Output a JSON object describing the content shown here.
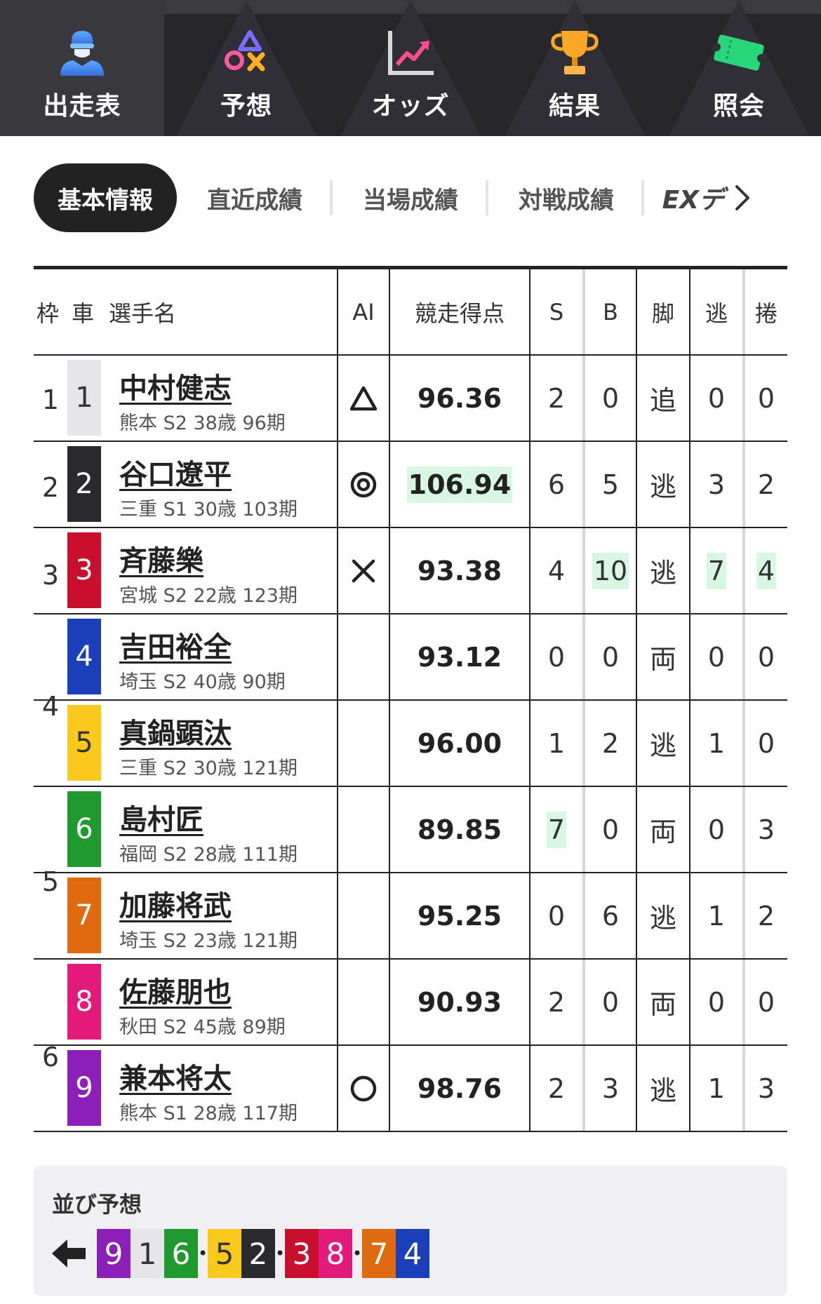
{
  "nav": {
    "items": [
      {
        "label": "出走表",
        "icon": "racer-icon",
        "active": true
      },
      {
        "label": "予想",
        "icon": "prediction-marks-icon",
        "active": false
      },
      {
        "label": "オッズ",
        "icon": "odds-chart-icon",
        "active": false
      },
      {
        "label": "結果",
        "icon": "trophy-icon",
        "active": false
      },
      {
        "label": "照会",
        "icon": "ticket-icon",
        "active": false
      }
    ]
  },
  "subtabs": {
    "items": [
      "基本情報",
      "直近成績",
      "当場成績",
      "対戦成績",
      "EXデ"
    ],
    "active": "基本情報"
  },
  "table": {
    "headers": {
      "waku": "枠",
      "car": "車",
      "name": "選手名",
      "ai": "AI",
      "score": "競走得点",
      "s": "S",
      "b": "B",
      "kyaku": "脚",
      "nige": "逃",
      "makuri": "捲"
    },
    "rows": [
      {
        "car": "1",
        "name": "中村健志",
        "info": "熊本 S2 38歳 96期",
        "ai": "△",
        "score": "96.36",
        "s": "2",
        "b": "0",
        "kyaku": "追",
        "nige": "0",
        "makuri": "0"
      },
      {
        "car": "2",
        "name": "谷口遼平",
        "info": "三重 S1 30歳 103期",
        "ai": "◎",
        "score": "106.94",
        "s": "6",
        "b": "5",
        "kyaku": "逃",
        "nige": "3",
        "makuri": "2"
      },
      {
        "car": "3",
        "name": "斉藤樂",
        "info": "宮城 S2 22歳 123期",
        "ai": "×",
        "score": "93.38",
        "s": "4",
        "b": "10",
        "kyaku": "逃",
        "nige": "7",
        "makuri": "4"
      },
      {
        "car": "4",
        "name": "吉田裕全",
        "info": "埼玉 S2 40歳 90期",
        "ai": "",
        "score": "93.12",
        "s": "0",
        "b": "0",
        "kyaku": "両",
        "nige": "0",
        "makuri": "0"
      },
      {
        "car": "5",
        "name": "真鍋顕汰",
        "info": "三重 S2 30歳 121期",
        "ai": "",
        "score": "96.00",
        "s": "1",
        "b": "2",
        "kyaku": "逃",
        "nige": "1",
        "makuri": "0"
      },
      {
        "car": "6",
        "name": "島村匠",
        "info": "福岡 S2 28歳 111期",
        "ai": "",
        "score": "89.85",
        "s": "7",
        "b": "0",
        "kyaku": "両",
        "nige": "0",
        "makuri": "3"
      },
      {
        "car": "7",
        "name": "加藤将武",
        "info": "埼玉 S2 23歳 121期",
        "ai": "",
        "score": "95.25",
        "s": "0",
        "b": "6",
        "kyaku": "逃",
        "nige": "1",
        "makuri": "2"
      },
      {
        "car": "8",
        "name": "佐藤朋也",
        "info": "秋田 S2 45歳 89期",
        "ai": "",
        "score": "90.93",
        "s": "2",
        "b": "0",
        "kyaku": "両",
        "nige": "0",
        "makuri": "0"
      },
      {
        "car": "9",
        "name": "兼本将太",
        "info": "熊本 S1 28歳 117期",
        "ai": "○",
        "score": "98.76",
        "s": "2",
        "b": "3",
        "kyaku": "逃",
        "nige": "1",
        "makuri": "3"
      }
    ],
    "waku_groups": [
      {
        "label": "1",
        "rows": [
          0
        ]
      },
      {
        "label": "2",
        "rows": [
          1
        ]
      },
      {
        "label": "3",
        "rows": [
          2
        ]
      },
      {
        "label": "4",
        "rows": [
          3,
          4
        ]
      },
      {
        "label": "5",
        "rows": [
          5,
          6
        ]
      },
      {
        "label": "6",
        "rows": [
          7,
          8
        ]
      }
    ],
    "highlighted": [
      "1.score",
      "2.b",
      "2.nige",
      "2.makuri",
      "5.s"
    ],
    "highlight_color": "#d9f8e4"
  },
  "car_colors": {
    "1": {
      "bg": "#e6e6ea",
      "fg": "#333333"
    },
    "2": {
      "bg": "#2a2a2e",
      "fg": "#ffffff"
    },
    "3": {
      "bg": "#c8102e",
      "fg": "#ffffff"
    },
    "4": {
      "bg": "#1a3fb8",
      "fg": "#ffffff"
    },
    "5": {
      "bg": "#f9c91c",
      "fg": "#333333"
    },
    "6": {
      "bg": "#1e9a2e",
      "fg": "#ffffff"
    },
    "7": {
      "bg": "#e06a10",
      "fg": "#ffffff"
    },
    "8": {
      "bg": "#e21b7a",
      "fg": "#ffffff"
    },
    "9": {
      "bg": "#8b1fb8",
      "fg": "#ffffff"
    }
  },
  "line_prediction": {
    "title": "並び予想",
    "direction_icon": "arrow-left-icon",
    "groups": [
      [
        "9",
        "1",
        "6"
      ],
      [
        "5",
        "2"
      ],
      [
        "3",
        "8"
      ],
      [
        "7",
        "4"
      ]
    ],
    "separator": "・"
  }
}
